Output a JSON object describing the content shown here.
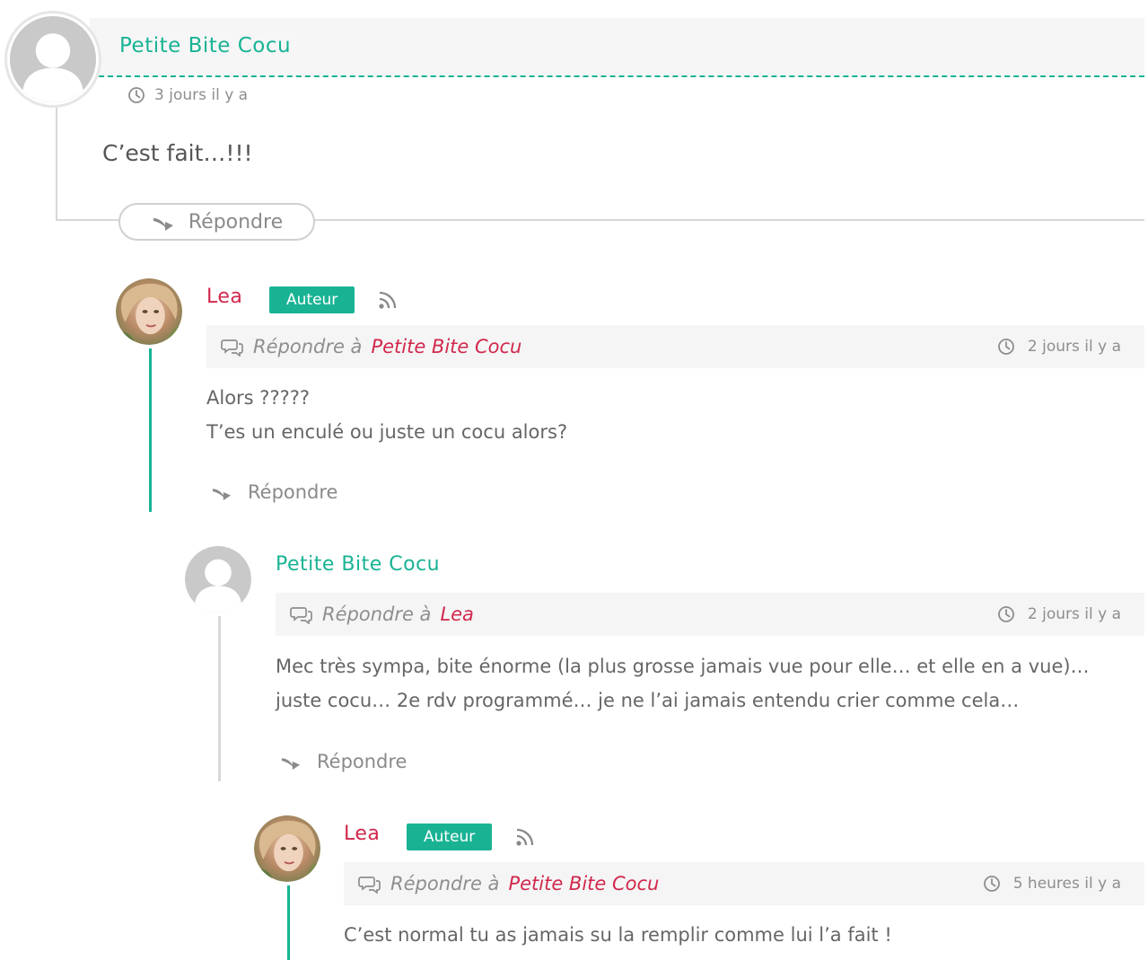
{
  "colors": {
    "accent_green": "#19b394",
    "author_red": "#d1284c",
    "meta_bg": "#f5f5f5",
    "muted_text": "#8e8e8e"
  },
  "comments": [
    {
      "author": "Petite Bite Cocu",
      "time": "3 jours il y a",
      "body": [
        "C’est fait…!!!"
      ],
      "reply_label": "Répondre",
      "avatar_icon": "default-user-avatar-icon"
    },
    {
      "author": "Lea",
      "badge": "Auteur",
      "reply_prefix": "Répondre à",
      "reply_to": "Petite Bite Cocu",
      "time": "2 jours il y a",
      "body": [
        "Alors ?????",
        "T’es un enculé ou juste un cocu alors?"
      ],
      "reply_label": "Répondre",
      "avatar_icon": "lea-photo-avatar"
    },
    {
      "author": "Petite Bite Cocu",
      "reply_prefix": "Répondre à",
      "reply_to": "Lea",
      "time": "2 jours il y a",
      "body": [
        "Mec très sympa, bite énorme (la plus grosse jamais vue pour elle… et elle en a vue)…",
        "juste cocu… 2e rdv programmé… je ne l’ai jamais entendu crier comme cela…"
      ],
      "reply_label": "Répondre",
      "avatar_icon": "default-user-avatar-icon"
    },
    {
      "author": "Lea",
      "badge": "Auteur",
      "reply_prefix": "Répondre à",
      "reply_to": "Petite Bite Cocu",
      "time": "5 heures il y a",
      "body": [
        "C’est normal tu as jamais su la remplir comme lui l’a fait !"
      ],
      "avatar_icon": "lea-photo-avatar"
    }
  ]
}
